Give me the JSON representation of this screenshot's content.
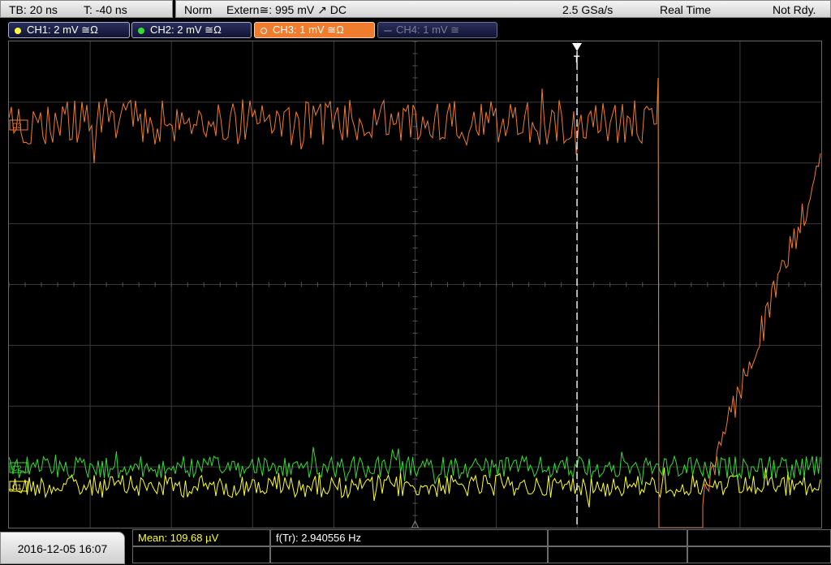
{
  "status": {
    "timebase": "TB: 20 ns",
    "trigger_time": "T: -40 ns",
    "trigger_mode": "Norm",
    "trigger_source": "Extern≅: 995 mV ↗ DC",
    "sample_rate": "2.5 GSa/s",
    "acq_mode": "Real Time",
    "state": "Not Rdy."
  },
  "channels": [
    {
      "label": "CH1: 2 mV ≅Ω",
      "color": "#ffff40",
      "active": true
    },
    {
      "label": "CH2: 2 mV ≅Ω",
      "color": "#33dd33",
      "active": true
    },
    {
      "label": "CH3: 1 mV ≅Ω",
      "color": "#f07c2e",
      "active": true,
      "selected": true
    },
    {
      "label": "CH4: 1 mV ≅",
      "color": "#666a80",
      "active": false
    }
  ],
  "waveforms": {
    "ch3_color": "#f07c2e",
    "ch2_color": "#33dd33",
    "ch1_color": "#ffff2a",
    "grid_color": "#3a3a3a",
    "trigger_marker": "T",
    "ch_markers": [
      "C1",
      "C2",
      "C3"
    ]
  },
  "footer": {
    "datetime": "2016-12-05 16:07",
    "measurements": [
      {
        "label": "Mean: 109.68 µV",
        "color": "#ffff2a"
      },
      {
        "label": "f(Tr): 2.940556 Hz",
        "color": "#ffffff"
      }
    ]
  }
}
